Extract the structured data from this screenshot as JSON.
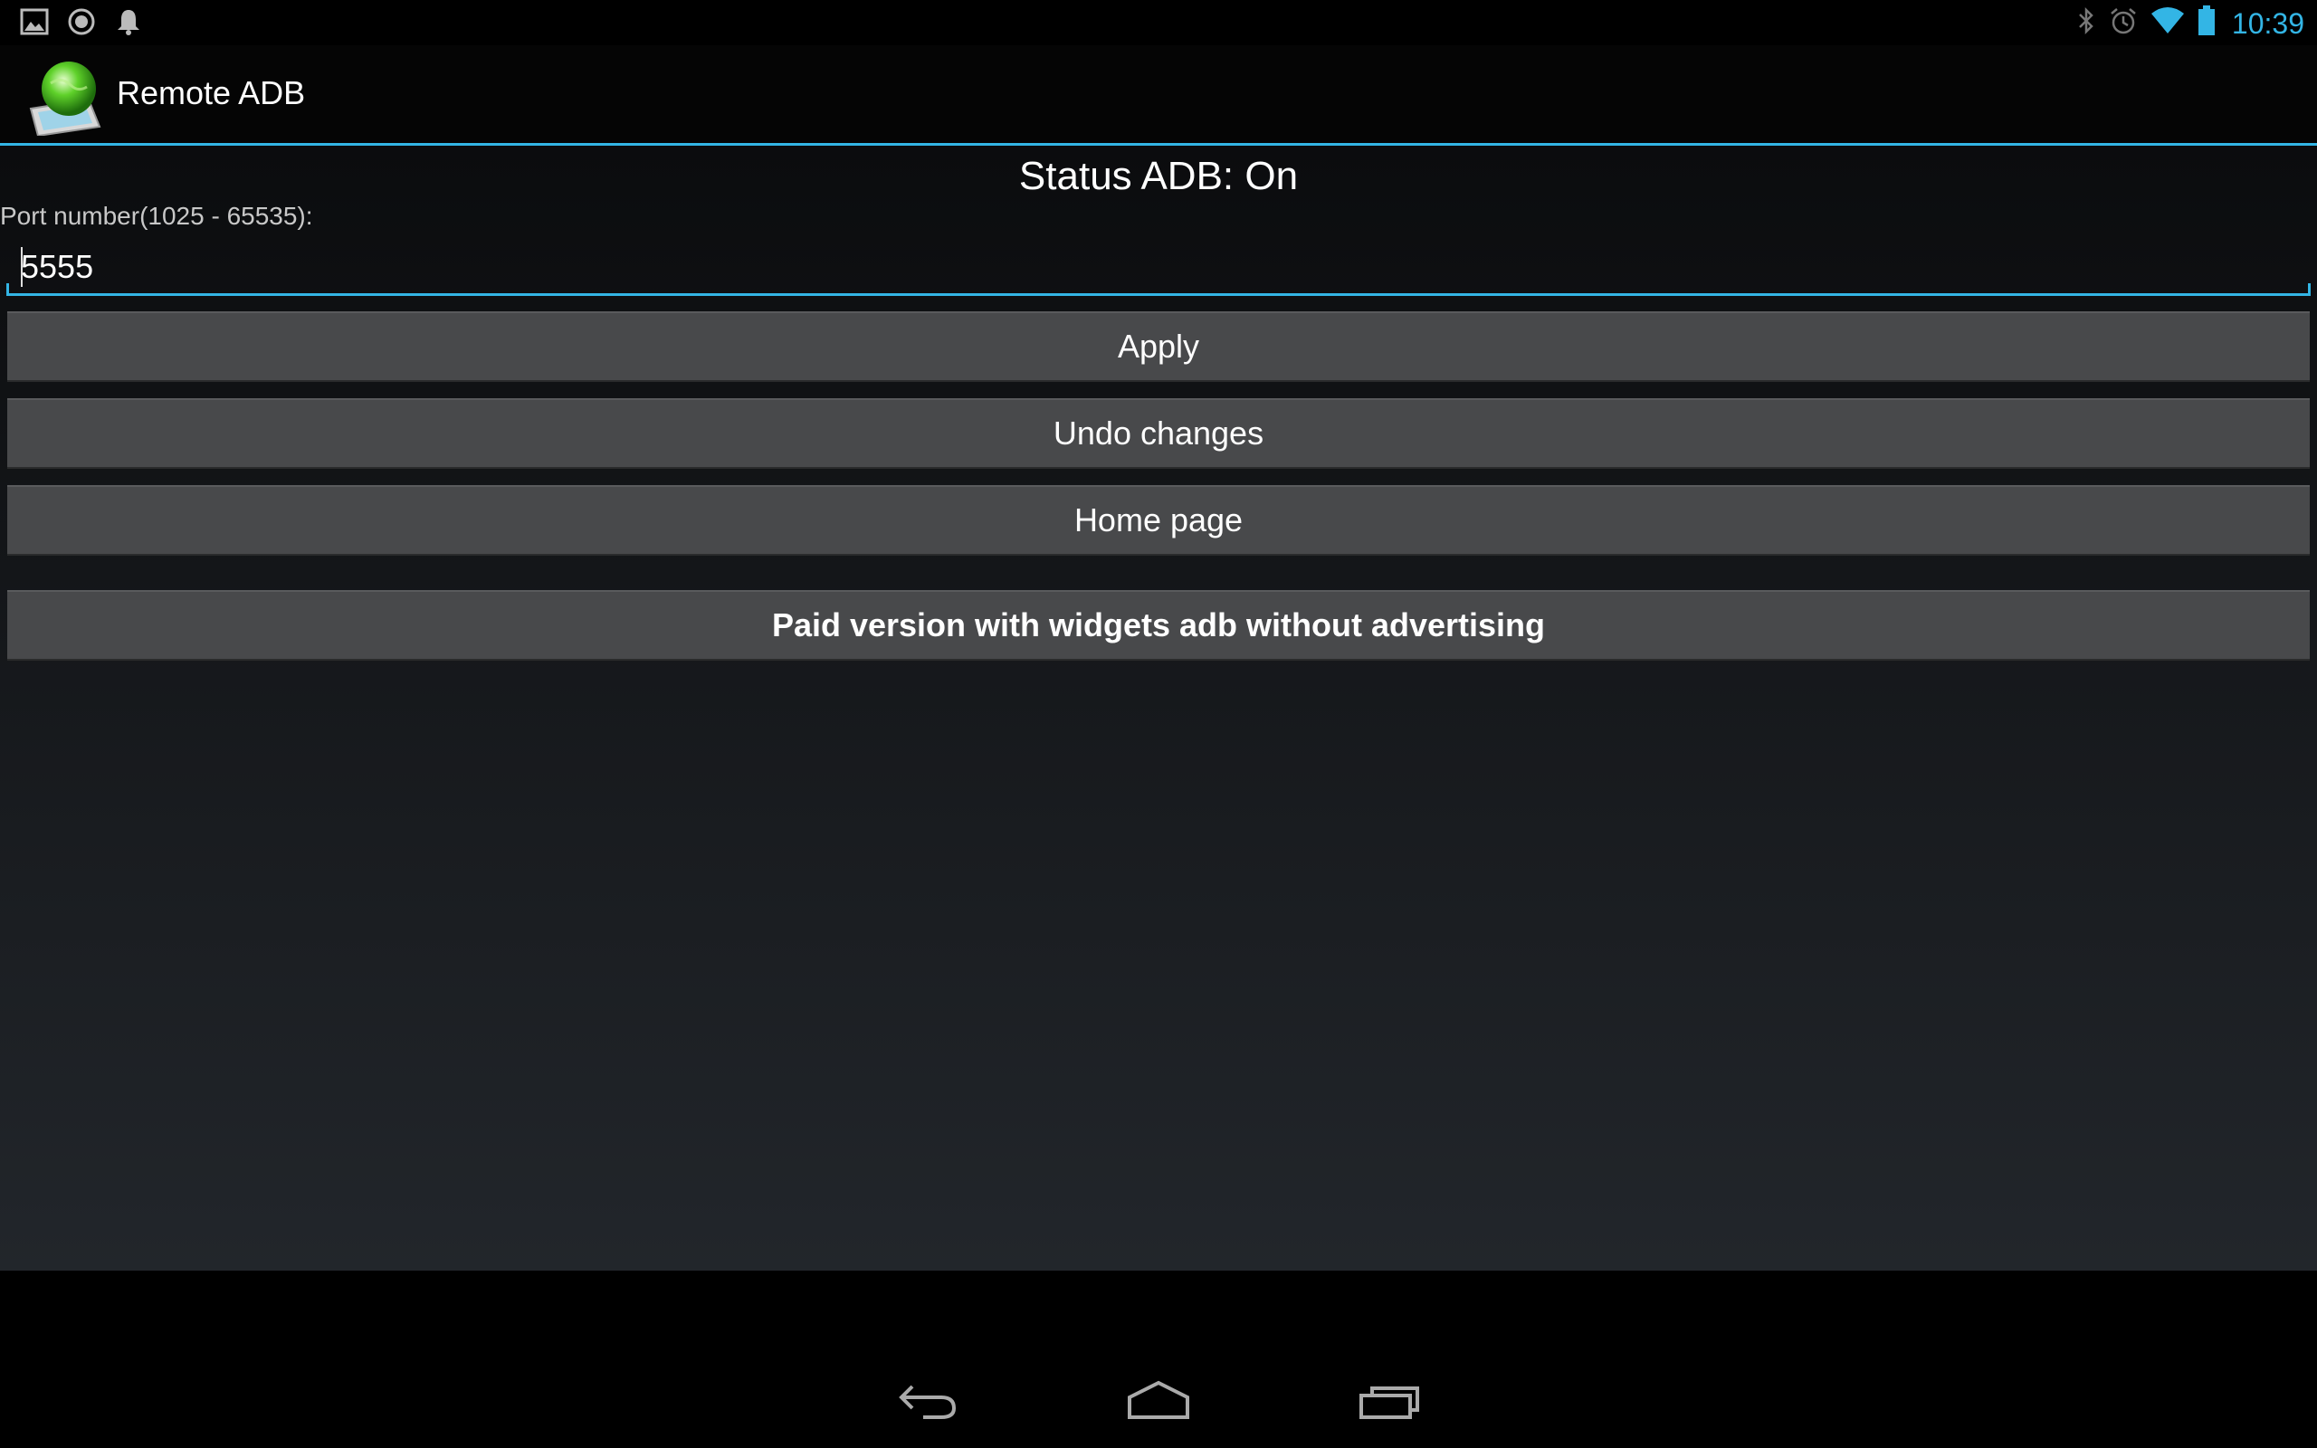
{
  "status_bar": {
    "left_icons": [
      "gallery-notification-icon",
      "sync-notification-icon",
      "bell-notification-icon"
    ],
    "right_icons": [
      "bluetooth-icon",
      "alarm-icon",
      "wifi-icon",
      "battery-icon"
    ],
    "time": "10:39",
    "accent_color": "#33b5e5"
  },
  "action_bar": {
    "app_icon": "remote-adb-globe-icon",
    "title": "Remote ADB"
  },
  "main": {
    "status_text": "Status ADB: On",
    "port_label": "Port number(1025 - 65535):",
    "port_value": "5555",
    "buttons": {
      "apply": "Apply",
      "undo": "Undo changes",
      "home_page": "Home page",
      "paid_version": "Paid version with widgets adb without advertising"
    }
  },
  "nav_bar": {
    "icons": [
      "back-icon",
      "home-icon",
      "recent-apps-icon"
    ]
  }
}
